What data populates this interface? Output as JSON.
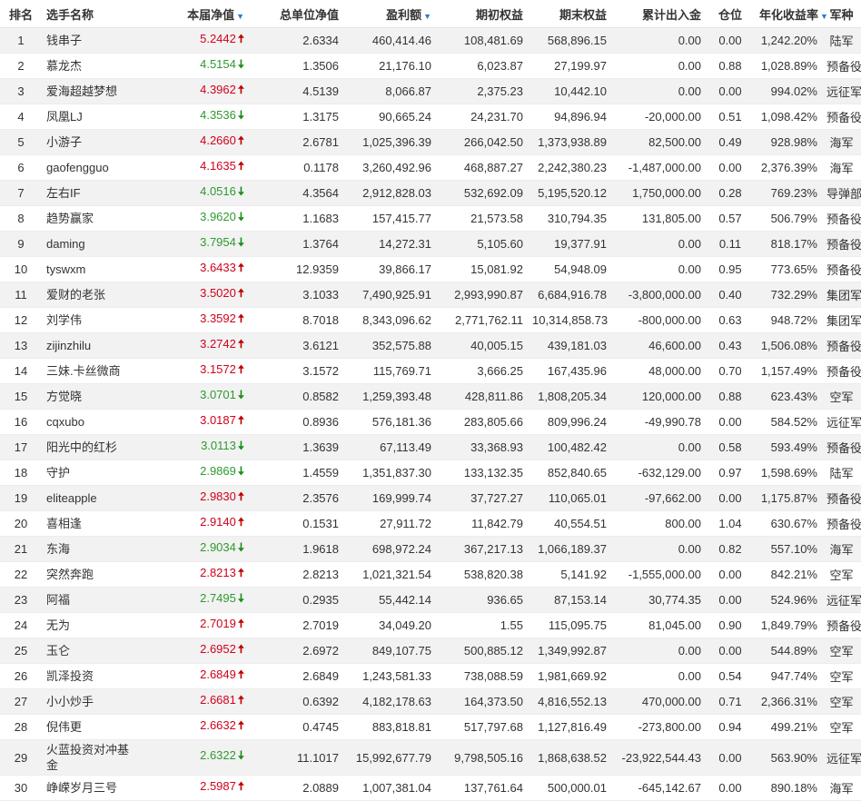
{
  "header": {
    "rank": "排名",
    "name": "选手名称",
    "nav": "本届净值",
    "unit_nav": "总单位净值",
    "profit": "盈利额",
    "initial_equity": "期初权益",
    "final_equity": "期末权益",
    "cum_flow": "累计出入金",
    "position": "仓位",
    "annual_return": "年化收益率",
    "army": "军种",
    "sort_icon": "▼"
  },
  "arrows": {
    "up": "🠅",
    "down": "🠇"
  },
  "rows": [
    {
      "rank": "1",
      "name": "钱串子",
      "nav": "5.2442",
      "dir": "up",
      "unit_nav": "2.6334",
      "profit": "460,414.46",
      "initial": "108,481.69",
      "final": "568,896.15",
      "flow": "0.00",
      "pos": "0.00",
      "annual": "1,242.20%",
      "army": "陆军"
    },
    {
      "rank": "2",
      "name": "慕龙杰",
      "nav": "4.5154",
      "dir": "down",
      "unit_nav": "1.3506",
      "profit": "21,176.10",
      "initial": "6,023.87",
      "final": "27,199.97",
      "flow": "0.00",
      "pos": "0.88",
      "annual": "1,028.89%",
      "army": "预备役"
    },
    {
      "rank": "3",
      "name": "爱海超越梦想",
      "nav": "4.3962",
      "dir": "up",
      "unit_nav": "4.5139",
      "profit": "8,066.87",
      "initial": "2,375.23",
      "final": "10,442.10",
      "flow": "0.00",
      "pos": "0.00",
      "annual": "994.02%",
      "army": "远征军"
    },
    {
      "rank": "4",
      "name": "凤凰LJ",
      "nav": "4.3536",
      "dir": "down",
      "unit_nav": "1.3175",
      "profit": "90,665.24",
      "initial": "24,231.70",
      "final": "94,896.94",
      "flow": "-20,000.00",
      "pos": "0.51",
      "annual": "1,098.42%",
      "army": "预备役"
    },
    {
      "rank": "5",
      "name": "小游子",
      "nav": "4.2660",
      "dir": "up",
      "unit_nav": "2.6781",
      "profit": "1,025,396.39",
      "initial": "266,042.50",
      "final": "1,373,938.89",
      "flow": "82,500.00",
      "pos": "0.49",
      "annual": "928.98%",
      "army": "海军"
    },
    {
      "rank": "6",
      "name": "gaofengguo",
      "nav": "4.1635",
      "dir": "up",
      "unit_nav": "0.1178",
      "profit": "3,260,492.96",
      "initial": "468,887.27",
      "final": "2,242,380.23",
      "flow": "-1,487,000.00",
      "pos": "0.00",
      "annual": "2,376.39%",
      "army": "海军"
    },
    {
      "rank": "7",
      "name": "左右IF",
      "nav": "4.0516",
      "dir": "down",
      "unit_nav": "4.3564",
      "profit": "2,912,828.03",
      "initial": "532,692.09",
      "final": "5,195,520.12",
      "flow": "1,750,000.00",
      "pos": "0.28",
      "annual": "769.23%",
      "army": "导弹部队"
    },
    {
      "rank": "8",
      "name": "趋势赢家",
      "nav": "3.9620",
      "dir": "down",
      "unit_nav": "1.1683",
      "profit": "157,415.77",
      "initial": "21,573.58",
      "final": "310,794.35",
      "flow": "131,805.00",
      "pos": "0.57",
      "annual": "506.79%",
      "army": "预备役"
    },
    {
      "rank": "9",
      "name": "daming",
      "nav": "3.7954",
      "dir": "down",
      "unit_nav": "1.3764",
      "profit": "14,272.31",
      "initial": "5,105.60",
      "final": "19,377.91",
      "flow": "0.00",
      "pos": "0.11",
      "annual": "818.17%",
      "army": "预备役"
    },
    {
      "rank": "10",
      "name": "tyswxm",
      "nav": "3.6433",
      "dir": "up",
      "unit_nav": "12.9359",
      "profit": "39,866.17",
      "initial": "15,081.92",
      "final": "54,948.09",
      "flow": "0.00",
      "pos": "0.95",
      "annual": "773.65%",
      "army": "预备役"
    },
    {
      "rank": "11",
      "name": "爱财的老张",
      "nav": "3.5020",
      "dir": "up",
      "unit_nav": "3.1033",
      "profit": "7,490,925.91",
      "initial": "2,993,990.87",
      "final": "6,684,916.78",
      "flow": "-3,800,000.00",
      "pos": "0.40",
      "annual": "732.29%",
      "army": "集团军"
    },
    {
      "rank": "12",
      "name": "刘学伟",
      "nav": "3.3592",
      "dir": "up",
      "unit_nav": "8.7018",
      "profit": "8,343,096.62",
      "initial": "2,771,762.11",
      "final": "10,314,858.73",
      "flow": "-800,000.00",
      "pos": "0.63",
      "annual": "948.72%",
      "army": "集团军"
    },
    {
      "rank": "13",
      "name": "zijinzhilu",
      "nav": "3.2742",
      "dir": "up",
      "unit_nav": "3.6121",
      "profit": "352,575.88",
      "initial": "40,005.15",
      "final": "439,181.03",
      "flow": "46,600.00",
      "pos": "0.43",
      "annual": "1,506.08%",
      "army": "预备役"
    },
    {
      "rank": "14",
      "name": "三妹.卡丝微商",
      "nav": "3.1572",
      "dir": "up",
      "unit_nav": "3.1572",
      "profit": "115,769.71",
      "initial": "3,666.25",
      "final": "167,435.96",
      "flow": "48,000.00",
      "pos": "0.70",
      "annual": "1,157.49%",
      "army": "预备役"
    },
    {
      "rank": "15",
      "name": "方觉晓",
      "nav": "3.0701",
      "dir": "down",
      "unit_nav": "0.8582",
      "profit": "1,259,393.48",
      "initial": "428,811.86",
      "final": "1,808,205.34",
      "flow": "120,000.00",
      "pos": "0.88",
      "annual": "623.43%",
      "army": "空军"
    },
    {
      "rank": "16",
      "name": "cqxubo",
      "nav": "3.0187",
      "dir": "up",
      "unit_nav": "0.8936",
      "profit": "576,181.36",
      "initial": "283,805.66",
      "final": "809,996.24",
      "flow": "-49,990.78",
      "pos": "0.00",
      "annual": "584.52%",
      "army": "远征军"
    },
    {
      "rank": "17",
      "name": "阳光中的红杉",
      "nav": "3.0113",
      "dir": "down",
      "unit_nav": "1.3639",
      "profit": "67,113.49",
      "initial": "33,368.93",
      "final": "100,482.42",
      "flow": "0.00",
      "pos": "0.58",
      "annual": "593.49%",
      "army": "预备役"
    },
    {
      "rank": "18",
      "name": "守护",
      "nav": "2.9869",
      "dir": "down",
      "unit_nav": "1.4559",
      "profit": "1,351,837.30",
      "initial": "133,132.35",
      "final": "852,840.65",
      "flow": "-632,129.00",
      "pos": "0.97",
      "annual": "1,598.69%",
      "army": "陆军"
    },
    {
      "rank": "19",
      "name": "eliteapple",
      "nav": "2.9830",
      "dir": "up",
      "unit_nav": "2.3576",
      "profit": "169,999.74",
      "initial": "37,727.27",
      "final": "110,065.01",
      "flow": "-97,662.00",
      "pos": "0.00",
      "annual": "1,175.87%",
      "army": "预备役"
    },
    {
      "rank": "20",
      "name": "喜相逢",
      "nav": "2.9140",
      "dir": "up",
      "unit_nav": "0.1531",
      "profit": "27,911.72",
      "initial": "11,842.79",
      "final": "40,554.51",
      "flow": "800.00",
      "pos": "1.04",
      "annual": "630.67%",
      "army": "预备役"
    },
    {
      "rank": "21",
      "name": "东海",
      "nav": "2.9034",
      "dir": "down",
      "unit_nav": "1.9618",
      "profit": "698,972.24",
      "initial": "367,217.13",
      "final": "1,066,189.37",
      "flow": "0.00",
      "pos": "0.82",
      "annual": "557.10%",
      "army": "海军"
    },
    {
      "rank": "22",
      "name": "突然奔跑",
      "nav": "2.8213",
      "dir": "up",
      "unit_nav": "2.8213",
      "profit": "1,021,321.54",
      "initial": "538,820.38",
      "final": "5,141.92",
      "flow": "-1,555,000.00",
      "pos": "0.00",
      "annual": "842.21%",
      "army": "空军"
    },
    {
      "rank": "23",
      "name": "阿福",
      "nav": "2.7495",
      "dir": "down",
      "unit_nav": "0.2935",
      "profit": "55,442.14",
      "initial": "936.65",
      "final": "87,153.14",
      "flow": "30,774.35",
      "pos": "0.00",
      "annual": "524.96%",
      "army": "远征军"
    },
    {
      "rank": "24",
      "name": "无为",
      "nav": "2.7019",
      "dir": "up",
      "unit_nav": "2.7019",
      "profit": "34,049.20",
      "initial": "1.55",
      "final": "115,095.75",
      "flow": "81,045.00",
      "pos": "0.90",
      "annual": "1,849.79%",
      "army": "预备役"
    },
    {
      "rank": "25",
      "name": "玉仑",
      "nav": "2.6952",
      "dir": "up",
      "unit_nav": "2.6972",
      "profit": "849,107.75",
      "initial": "500,885.12",
      "final": "1,349,992.87",
      "flow": "0.00",
      "pos": "0.00",
      "annual": "544.89%",
      "army": "空军"
    },
    {
      "rank": "26",
      "name": "凯泽投资",
      "nav": "2.6849",
      "dir": "up",
      "unit_nav": "2.6849",
      "profit": "1,243,581.33",
      "initial": "738,088.59",
      "final": "1,981,669.92",
      "flow": "0.00",
      "pos": "0.54",
      "annual": "947.74%",
      "army": "空军"
    },
    {
      "rank": "27",
      "name": "小小炒手",
      "nav": "2.6681",
      "dir": "up",
      "unit_nav": "0.6392",
      "profit": "4,182,178.63",
      "initial": "164,373.50",
      "final": "4,816,552.13",
      "flow": "470,000.00",
      "pos": "0.71",
      "annual": "2,366.31%",
      "army": "空军"
    },
    {
      "rank": "28",
      "name": "倪伟更",
      "nav": "2.6632",
      "dir": "up",
      "unit_nav": "0.4745",
      "profit": "883,818.81",
      "initial": "517,797.68",
      "final": "1,127,816.49",
      "flow": "-273,800.00",
      "pos": "0.94",
      "annual": "499.21%",
      "army": "空军"
    },
    {
      "rank": "29",
      "name": "火蓝投资对冲基金",
      "nav": "2.6322",
      "dir": "down",
      "unit_nav": "11.1017",
      "profit": "15,992,677.79",
      "initial": "9,798,505.16",
      "final": "1,868,638.52",
      "flow": "-23,922,544.43",
      "pos": "0.00",
      "annual": "563.90%",
      "army": "远征军",
      "tall": true
    },
    {
      "rank": "30",
      "name": "峥嵘岁月三号",
      "nav": "2.5987",
      "dir": "up",
      "unit_nav": "2.0889",
      "profit": "1,007,381.04",
      "initial": "137,761.64",
      "final": "500,000.01",
      "flow": "-645,142.67",
      "pos": "0.00",
      "annual": "890.18%",
      "army": "海军"
    }
  ]
}
